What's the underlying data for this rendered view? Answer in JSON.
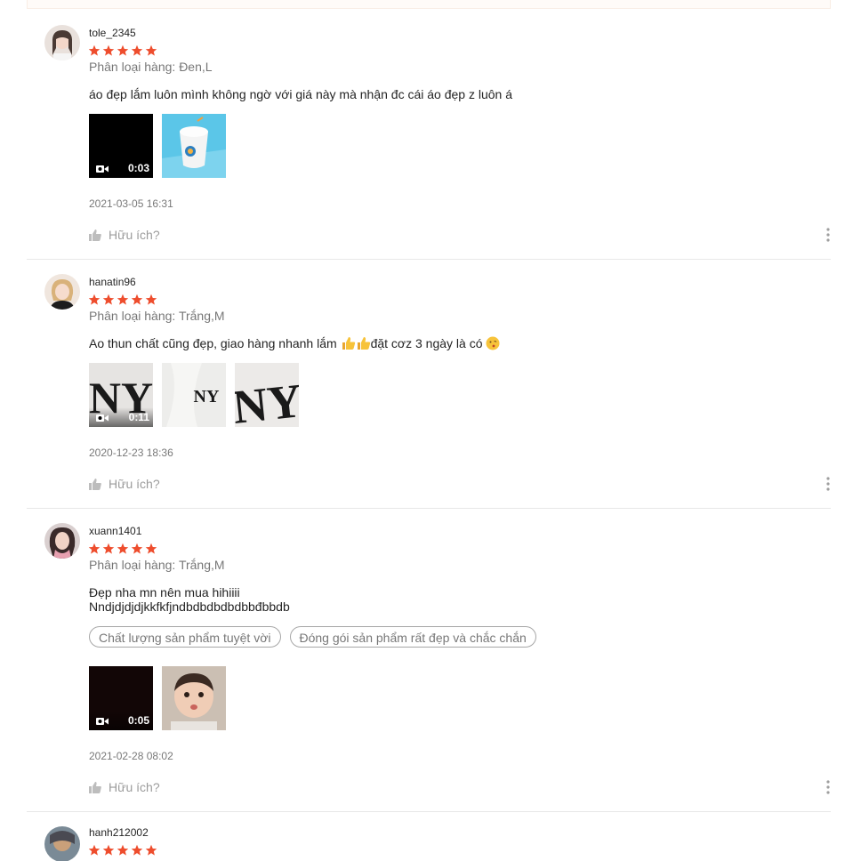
{
  "reviews": [
    {
      "username": "tole_2345",
      "rating": 5,
      "variant": "Phân loại hàng: Đen,L",
      "comment_lines": [
        "áo đẹp lắm luôn mình không ngờ với giá này mà nhận đc cái áo đẹp z luôn á"
      ],
      "video_duration": "0:03",
      "date": "2021-03-05 16:31",
      "helpful_label": "Hữu ích?"
    },
    {
      "username": "hanatin96",
      "rating": 5,
      "variant": "Phân loại hàng: Trắng,M",
      "comment_prefix": "Ao thun chất cũng đẹp, giao hàng nhanh lắm ",
      "comment_suffix": "đặt cơz 3 ngày là có ",
      "emojis": [
        "thumbs-up-emoji",
        "thumbs-up-emoji",
        "kissing-face-emoji"
      ],
      "video_duration": "0:11",
      "date": "2020-12-23 18:36",
      "helpful_label": "Hữu ích?"
    },
    {
      "username": "xuann1401",
      "rating": 5,
      "variant": "Phân loại hàng: Trắng,M",
      "comment_lines": [
        "Đẹp nha mn nên mua hihiiii",
        "Nndjdjdjdjkkfkfjndbdbdbdbdbbđbbdb"
      ],
      "tags": [
        "Chất lượng sản phẩm tuyệt vời",
        "Đóng gói sản phẩm rất đẹp và chắc chắn"
      ],
      "video_duration": "0:05",
      "date": "2021-02-28 08:02",
      "helpful_label": "Hữu ích?"
    },
    {
      "username": "hanh212002",
      "rating": 5
    }
  ],
  "colors": {
    "star": "#ee4d2d",
    "border": "#e8e8e8",
    "muted_text": "#8a8a8a"
  },
  "icons": [
    "star-icon",
    "camera-icon",
    "thumbs-up-icon",
    "more-vertical-icon"
  ]
}
